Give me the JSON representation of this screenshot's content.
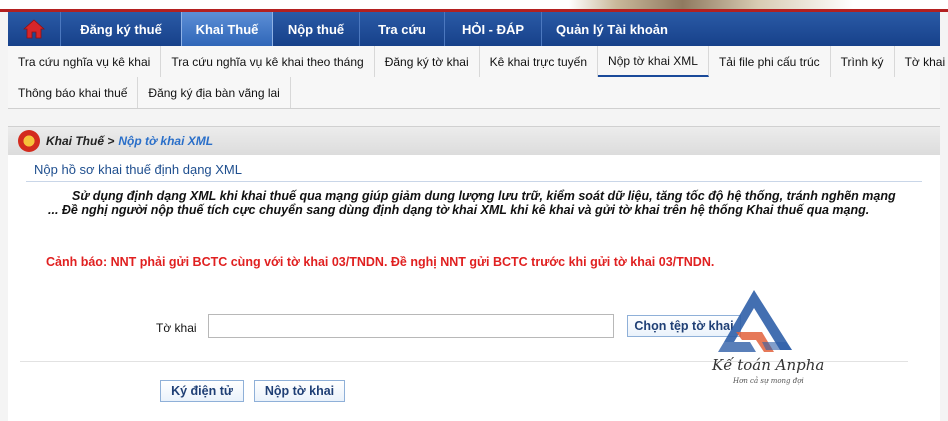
{
  "main_nav": {
    "home_icon": "home-icon",
    "items": [
      {
        "label": "Đăng ký thuế"
      },
      {
        "label": "Khai Thuế"
      },
      {
        "label": "Nộp thuế"
      },
      {
        "label": "Tra cứu"
      },
      {
        "label": "HỎI - ĐÁP"
      },
      {
        "label": "Quản lý Tài khoản"
      }
    ]
  },
  "sub_nav": {
    "row1": [
      {
        "label": "Tra cứu nghĩa vụ kê khai"
      },
      {
        "label": "Tra cứu nghĩa vụ kê khai theo tháng"
      },
      {
        "label": "Đăng ký tờ khai"
      },
      {
        "label": "Kê khai trực tuyến"
      },
      {
        "label": "Nộp tờ khai XML"
      },
      {
        "label": "Tải file phi cấu trúc"
      },
      {
        "label": "Trình ký"
      },
      {
        "label": "Tờ khai"
      }
    ],
    "row2": [
      {
        "label": "Thông báo khai thuế"
      },
      {
        "label": "Đăng ký địa bàn vãng lai"
      }
    ]
  },
  "breadcrumb": {
    "parent": "Khai Thuế >",
    "current": "Nộp tờ khai XML"
  },
  "panel": {
    "title": "Nộp hồ sơ khai thuế định dạng XML",
    "intro": "Sử dụng định dạng XML khi khai thuế qua mạng giúp giảm dung lượng lưu trữ, kiểm soát dữ liệu, tăng tốc độ hệ thống, tránh nghẽn mạng ... Đề nghị người nộp thuế tích cực chuyển sang dùng định dạng tờ khai XML khi kê khai và gửi tờ khai trên hệ thống Khai thuế qua mạng.",
    "warning": "Cảnh báo: NNT phải gửi BCTC cùng với tờ khai 03/TNDN. Đề nghị NNT gửi BCTC trước khi gửi tờ khai 03/TNDN."
  },
  "form": {
    "file_label": "Tờ khai",
    "file_value": "",
    "choose_button": "Chọn tệp tờ khai",
    "sign_button": "Ký điện tử",
    "submit_button": "Nộp tờ khai"
  },
  "watermark": {
    "brand": "Kế toán Anpha",
    "slogan": "Hơn cả sự mong đợi"
  },
  "colors": {
    "nav_blue": "#17418a",
    "nav_active": "#2f66b8",
    "warning_red": "#e02020",
    "title_blue": "#1f4f8f"
  }
}
